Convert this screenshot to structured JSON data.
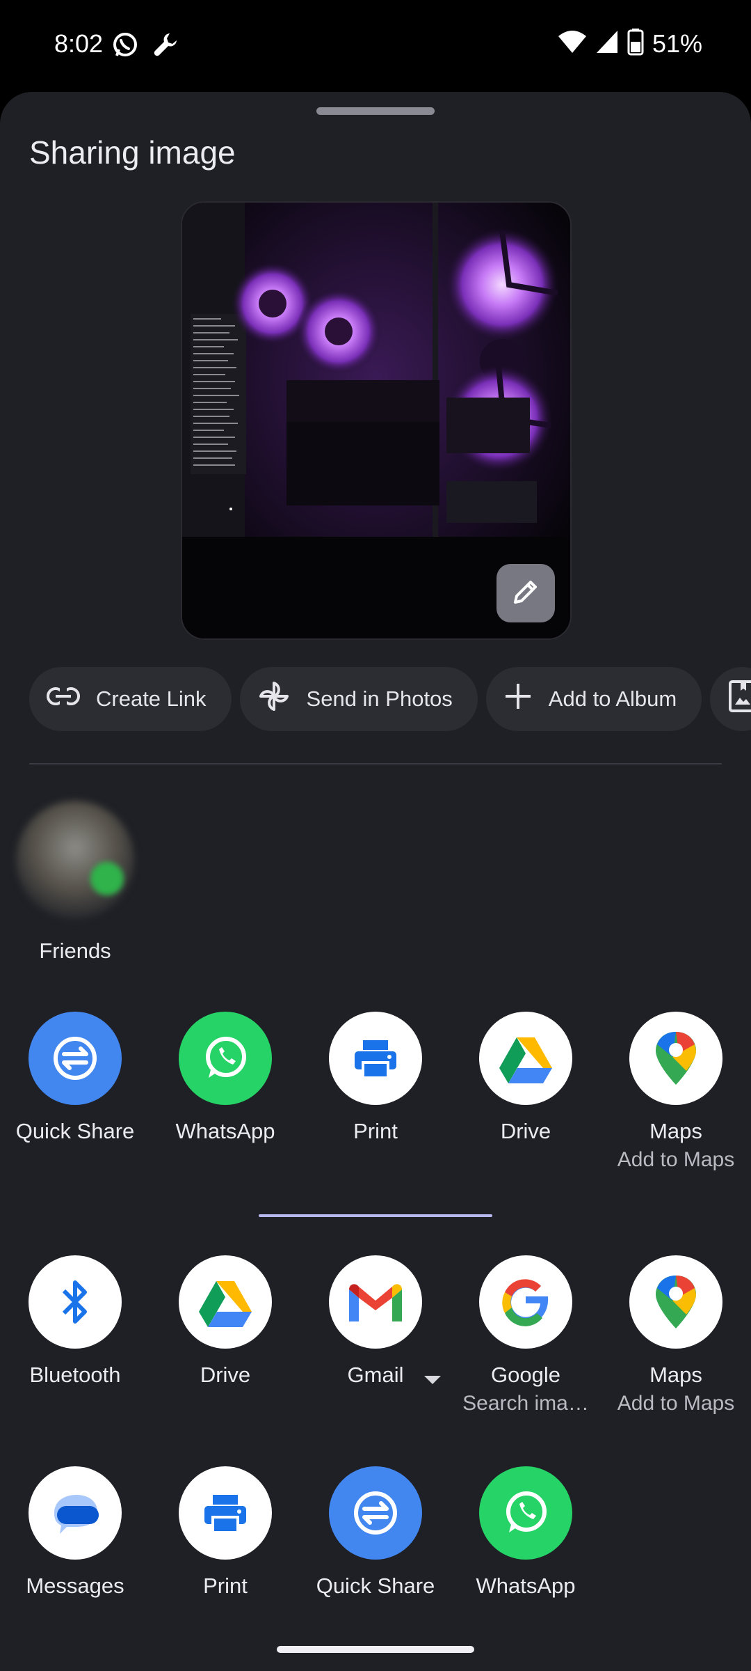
{
  "status_bar": {
    "time": "8:02",
    "battery": "51%",
    "icons": [
      "whatsapp-icon",
      "wrench-icon",
      "wifi-icon",
      "signal-icon",
      "battery-icon"
    ]
  },
  "sheet": {
    "title": "Sharing image"
  },
  "chips": [
    {
      "label": "Create Link",
      "icon": "link-icon"
    },
    {
      "label": "Send in Photos",
      "icon": "pinwheel-icon"
    },
    {
      "label": "Add to Album",
      "icon": "plus-icon"
    },
    {
      "label": "",
      "icon": "album-icon"
    }
  ],
  "contact": {
    "name": "Friends"
  },
  "direct_apps": [
    {
      "label": "Quick Share",
      "sublabel": "",
      "icon": "quick-share-icon"
    },
    {
      "label": "WhatsApp",
      "sublabel": "",
      "icon": "whatsapp-icon"
    },
    {
      "label": "Print",
      "sublabel": "",
      "icon": "print-icon"
    },
    {
      "label": "Drive",
      "sublabel": "",
      "icon": "drive-icon"
    },
    {
      "label": "Maps",
      "sublabel": "Add to Maps",
      "icon": "maps-icon"
    }
  ],
  "all_apps_row1": [
    {
      "label": "Bluetooth",
      "sublabel": "",
      "icon": "bluetooth-icon"
    },
    {
      "label": "Drive",
      "sublabel": "",
      "icon": "drive-icon"
    },
    {
      "label": "Gmail",
      "sublabel": "",
      "icon": "gmail-icon"
    },
    {
      "label": "Google",
      "sublabel": "Search ima…",
      "icon": "google-icon"
    },
    {
      "label": "Maps",
      "sublabel": "Add to Maps",
      "icon": "maps-icon"
    }
  ],
  "all_apps_row2": [
    {
      "label": "Messages",
      "sublabel": "",
      "icon": "messages-icon"
    },
    {
      "label": "Print",
      "sublabel": "",
      "icon": "print-icon"
    },
    {
      "label": "Quick Share",
      "sublabel": "",
      "icon": "quick-share-icon"
    },
    {
      "label": "WhatsApp",
      "sublabel": "",
      "icon": "whatsapp-icon"
    }
  ],
  "colors": {
    "sheet_bg": "#1f2025",
    "chip_bg": "#2c2d33",
    "accent_divider": "#b7b8ee",
    "quick_share_blue": "#4286f0",
    "whatsapp_green": "#25d366"
  }
}
